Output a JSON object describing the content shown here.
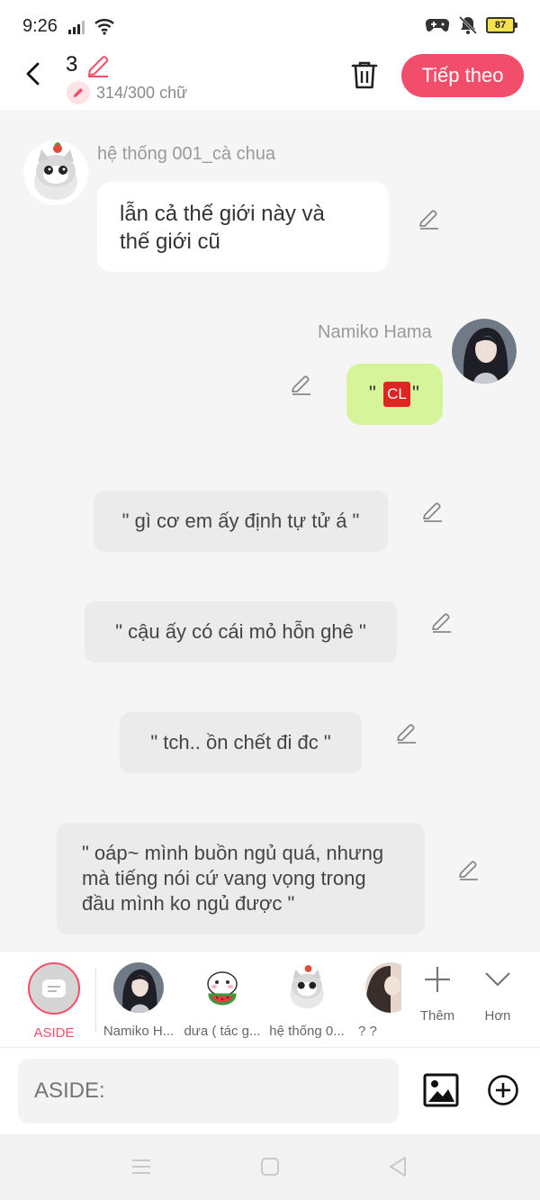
{
  "status_bar": {
    "time": "9:26",
    "battery": "87"
  },
  "header": {
    "count": "3",
    "word_count": "314/300 chữ",
    "next_label": "Tiếp theo"
  },
  "messages": [
    {
      "type": "left",
      "sender": "hệ thống 001_cà chua",
      "lines": [
        "lẫn cả thế giới này và",
        "thế giới cũ"
      ]
    },
    {
      "type": "right",
      "sender": "Namiko Hama",
      "text_prefix": "\"",
      "badge": "CL",
      "text_suffix": "\""
    },
    {
      "type": "aside",
      "text": "\" gì cơ em ấy định tự tử á \""
    },
    {
      "type": "aside",
      "text": "\" cậu ấy có cái mỏ hỗn ghê \""
    },
    {
      "type": "aside",
      "text": "\" tch.. ồn chết đi đc \""
    },
    {
      "type": "aside",
      "lines": [
        "\" oáp~ mình buồn ngủ quá, nhưng",
        "mà tiếng nói cứ vang vọng trong",
        "đầu mình ko ngủ được \""
      ]
    }
  ],
  "character_bar": {
    "aside_label": "ASIDE",
    "characters": [
      "Namiko H...",
      "dưa ( tác g...",
      "hệ thống 0...",
      "? ?"
    ],
    "add_label": "Thêm",
    "more_label": "Hơn"
  },
  "input": {
    "placeholder": "ASIDE:"
  },
  "colors": {
    "accent": "#f24e6b",
    "green_bubble": "#d6f49a",
    "aside_bubble": "#ebebeb"
  }
}
